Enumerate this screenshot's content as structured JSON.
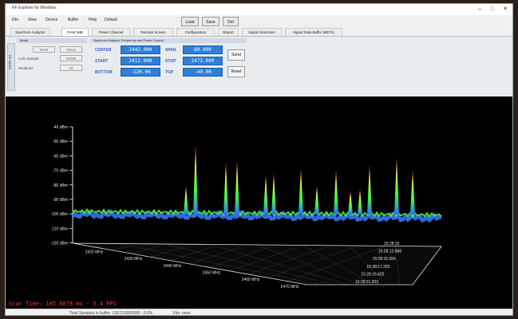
{
  "window": {
    "title": "RF Explorer for Windows"
  },
  "menu": [
    "File",
    "View",
    "Device",
    "Buffer",
    "Help",
    "Default"
  ],
  "toolbar": {
    "load": "Load",
    "save": "Save",
    "del": "Del"
  },
  "tabs": [
    "Spectrum Analyzer",
    "RAW IMB",
    "Power Channel",
    "Remote Screen",
    "Configuration",
    "Report",
    "Signal Generator",
    "Signal Data Buffer (BETA)"
  ],
  "active_tab": 1,
  "controls": {
    "side_label": "RF MODE",
    "mode_header": "Mode",
    "mode_left": "RUN",
    "mode_right": "HOLD",
    "calc_label": "Calc Sample",
    "calc_value": "NONE",
    "iterations_label": "Iterations",
    "iterations_value": "16",
    "freq_header": "Spectrum Analyzer Frequency and Power Control",
    "center_label": "CENTER",
    "center_value": "2442.000",
    "start_label": "START",
    "start_value": "2412.000",
    "bottom_label": "BOTTOM",
    "bottom_value": "-120.00",
    "span_label": "SPAN",
    "span_value": "60.000",
    "stop_label": "STOP",
    "stop_value": "2472.000",
    "top_label": "TOP",
    "top_value": "-40.00",
    "send": "Send",
    "reset": "Reset"
  },
  "plot": {
    "y_ticks": [
      "-40 dBm",
      "-50 dBm",
      "-60 dBm",
      "-70 dBm",
      "-80 dBm",
      "-90 dBm",
      "-100 dBm",
      "-110 dBm",
      "-120 dBm"
    ],
    "x_ticks": [
      "2420 MHz",
      "2430 MHz",
      "2440 MHz",
      "2450 MHz",
      "2460 MHz",
      "2470 MHz"
    ],
    "time_ticks": [
      "15:28:21.823",
      "15:28:19.425",
      "15:28:17.255",
      "15:28:15.055",
      "15:28:12.688",
      "15:28:10"
    ],
    "scan_time": "Scan Time: 185.8878 ms - 5.4 FPS",
    "colors": {
      "low": "#2a6cff",
      "mid": "#3cff3c",
      "high": "#ff4040",
      "grid": "#e6e6e6"
    }
  },
  "status": {
    "samples": "Total Samples in buffer: 1367/10000000 - 0.0%",
    "file": "File: none"
  }
}
